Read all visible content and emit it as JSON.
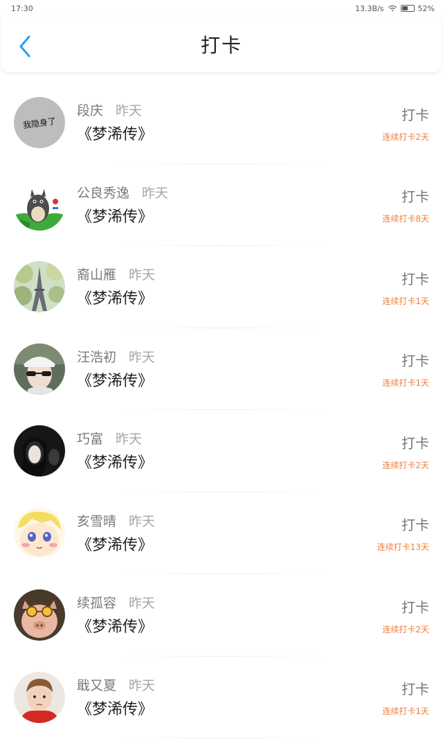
{
  "status_bar": {
    "time": "17:30",
    "network_speed": "13.3B/s",
    "battery_percent": "52%",
    "battery_level": 0.52
  },
  "header": {
    "back_icon": "chevron-left-icon",
    "title": "打卡"
  },
  "colors": {
    "accent_blue": "#2a9ff0",
    "streak_orange": "#ef7d3c"
  },
  "entries": [
    {
      "name": "段庆",
      "time": "昨天",
      "book": "《梦浠传》",
      "action": "打卡",
      "streak": "连续打卡2天",
      "avatar_text": "我隐身了"
    },
    {
      "name": "公良秀逸",
      "time": "昨天",
      "book": "《梦浠传》",
      "action": "打卡",
      "streak": "连续打卡8天"
    },
    {
      "name": "裔山雁",
      "time": "昨天",
      "book": "《梦浠传》",
      "action": "打卡",
      "streak": "连续打卡1天"
    },
    {
      "name": "汪浩初",
      "time": "昨天",
      "book": "《梦浠传》",
      "action": "打卡",
      "streak": "连续打卡1天"
    },
    {
      "name": "巧富",
      "time": "昨天",
      "book": "《梦浠传》",
      "action": "打卡",
      "streak": "连续打卡2天"
    },
    {
      "name": "亥雪晴",
      "time": "昨天",
      "book": "《梦浠传》",
      "action": "打卡",
      "streak": "连续打卡13天"
    },
    {
      "name": "续孤容",
      "time": "昨天",
      "book": "《梦浠传》",
      "action": "打卡",
      "streak": "连续打卡2天"
    },
    {
      "name": "戢又夏",
      "time": "昨天",
      "book": "《梦浠传》",
      "action": "打卡",
      "streak": "连续打卡1天"
    }
  ]
}
